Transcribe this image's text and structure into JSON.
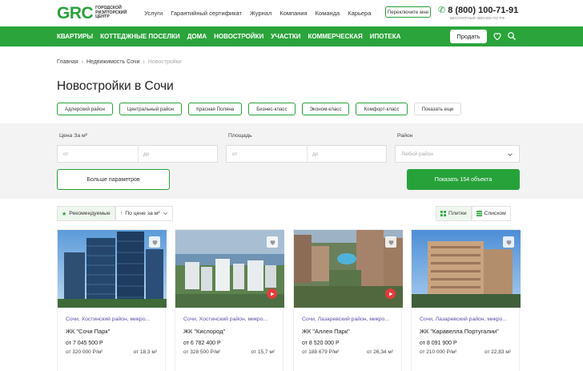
{
  "header": {
    "logo": "GRC",
    "logo_sub": "городской риэлторский центр",
    "nav": [
      "Услуги",
      "Гарантийный сертификат",
      "Журнал",
      "Компания",
      "Команда",
      "Карьера"
    ],
    "switch_label": "Переключите мне",
    "phone": "8 (800) 100-71-91",
    "phone_sub": "бесплатный звонок по РФ"
  },
  "mainnav": {
    "items": [
      "Квартиры",
      "Коттеджные поселки",
      "Дома",
      "Новостройки",
      "Участки",
      "Коммерческая",
      "Ипотека"
    ],
    "sell_label": "Продать"
  },
  "breadcrumbs": [
    "Главная",
    "Недвижимость Сочи",
    "Новостройки"
  ],
  "title": "Новостройки в Сочи",
  "chips": [
    "Адлерский район",
    "Центральный район",
    "Красная Поляна",
    "Бизнес-класс",
    "Эконом-класс",
    "Комфорт-класс",
    "Показать еще"
  ],
  "filter": {
    "price_label": "Цена За м²",
    "price_from": "от",
    "price_to": "до",
    "area_label": "Площадь",
    "area_from": "от",
    "area_to": "до",
    "district_label": "Район",
    "district_placeholder": "Любой район",
    "more_label": "Больше параметров",
    "show_label": "Показать 154 объекта"
  },
  "sort": {
    "recommended": "Рекомендуемые",
    "by_price": "По цене за м²",
    "tiles": "Плитки",
    "list": "Списком"
  },
  "cards": [
    {
      "location": "Сочи, Хостинский район, микро...",
      "name": "ЖК \"Сочи Парк\"",
      "price": "от 7 045 500 Р",
      "ppm": "от 320 000 Р/м²",
      "area": "от 18,3 м²",
      "video": false
    },
    {
      "location": "Сочи, Хостинский район, микро...",
      "name": "ЖК \"Кислород\"",
      "price": "от 6 782 400 Р",
      "ppm": "от 328 500 Р/м²",
      "area": "от 15,7 м²",
      "video": true
    },
    {
      "location": "Сочи, Лазаревский район, микро...",
      "name": "ЖК \"Аллея Парк\"",
      "price": "от 8 520 000 Р",
      "ppm": "от 188 679 Р/м²",
      "area": "от 26,34 м²",
      "video": true
    },
    {
      "location": "Сочи, Лазаревский район, микро...",
      "name": "ЖК \"Каравелла Португалии\"",
      "price": "от 8 091 900 Р",
      "ppm": "от 210 000 Р/м²",
      "area": "от 22,83 м²",
      "video": false
    }
  ],
  "colors": {
    "brand_green": "#2ba43b",
    "location_purple": "#5a4ea8",
    "video_red": "#e23b3b"
  }
}
